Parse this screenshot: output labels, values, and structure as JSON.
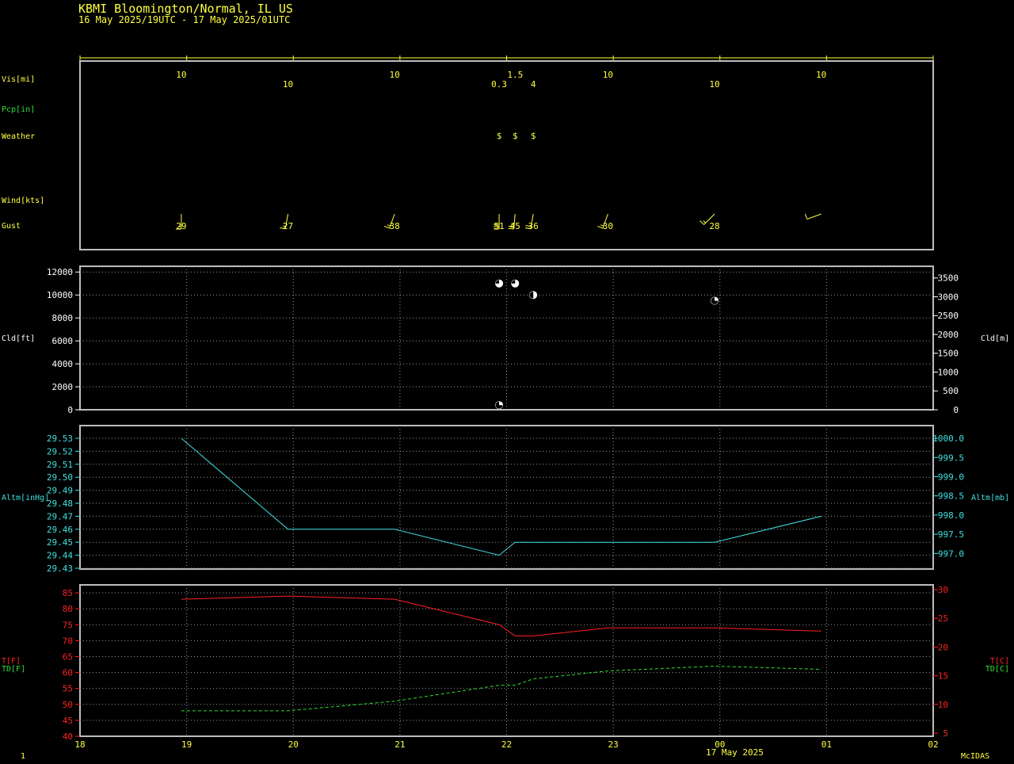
{
  "header": {
    "station": "KBMI  Bloomington/Normal, IL US",
    "period": "16 May 2025/19UTC - 17 May 2025/01UTC"
  },
  "footer": {
    "left_number": "1",
    "credit": "McIDAS",
    "date_label": "17 May 2025"
  },
  "colors": {
    "background": "#000000",
    "frame": "#bdbdbd",
    "yellow": "#ffff40",
    "green": "#30e030",
    "cyan": "#40e0e0",
    "red": "#ff2020",
    "white": "#ffffff"
  },
  "labels": {
    "vis": "Vis[mi]",
    "pcp": "Pcp[in]",
    "weather": "Weather",
    "wind": "Wind[kts]",
    "gust": "Gust",
    "cld_ft": "Cld[ft]",
    "cld_m": "Cld[m]",
    "altm_inhg": "Altm[inHg]",
    "altm_mb": "Altm[mb]",
    "t_f": "T[F]",
    "td_f": "TD[F]",
    "t_c": "T[C]",
    "td_c": "TD[C]"
  },
  "chart_data": {
    "type": "line",
    "x_axis": {
      "unit": "hour UTC",
      "range": [
        18,
        26
      ],
      "ticks": [
        18,
        19,
        20,
        21,
        22,
        23,
        24,
        25,
        26
      ],
      "tick_labels": [
        "18",
        "19",
        "20",
        "21",
        "22",
        "23",
        "00",
        "01",
        "02"
      ]
    },
    "observations": [
      {
        "time": 18.95,
        "vis": "10",
        "vis_level": "upper",
        "weather": "",
        "wind_dir": 180,
        "wind_speed": 15,
        "gust": "29"
      },
      {
        "time": 19.95,
        "vis": "10",
        "vis_level": "lower",
        "weather": "",
        "wind_dir": 190,
        "wind_speed": 15,
        "gust": "27"
      },
      {
        "time": 20.95,
        "vis": "10",
        "vis_level": "upper",
        "weather": "",
        "wind_dir": 200,
        "wind_speed": 15,
        "gust": "38"
      },
      {
        "time": 21.93,
        "vis": "0.3",
        "vis_level": "lower",
        "weather": "$",
        "wind_dir": 180,
        "wind_speed": 30,
        "gust": "51"
      },
      {
        "time": 22.08,
        "vis": "1.5",
        "vis_level": "upper",
        "weather": "$",
        "wind_dir": 185,
        "wind_speed": 25,
        "gust": "45"
      },
      {
        "time": 22.25,
        "vis": "4",
        "vis_level": "lower",
        "weather": "$",
        "wind_dir": 190,
        "wind_speed": 20,
        "gust": "36"
      },
      {
        "time": 22.95,
        "vis": "10",
        "vis_level": "upper",
        "weather": "",
        "wind_dir": 200,
        "wind_speed": 15,
        "gust": "30"
      },
      {
        "time": 23.95,
        "vis": "10",
        "vis_level": "lower",
        "weather": "",
        "wind_dir": 225,
        "wind_speed": 15,
        "gust": "28"
      },
      {
        "time": 24.95,
        "vis": "10",
        "vis_level": "upper",
        "weather": "",
        "wind_dir": 250,
        "wind_speed": 10,
        "gust": ""
      }
    ],
    "cloud": {
      "ylabel_left": "Cld[ft]",
      "ylabel_right": "Cld[m]",
      "ylim_ft": [
        0,
        12500
      ],
      "yticks_ft": [
        0,
        2000,
        4000,
        6000,
        8000,
        10000,
        12000
      ],
      "yticks_m": [
        0,
        500,
        1000,
        1500,
        2000,
        2500,
        3000,
        3500
      ],
      "points": [
        {
          "time": 21.93,
          "height_ft": 11000,
          "cover": "broken"
        },
        {
          "time": 22.08,
          "height_ft": 11000,
          "cover": "broken"
        },
        {
          "time": 22.25,
          "height_ft": 10000,
          "cover": "scattered"
        },
        {
          "time": 23.95,
          "height_ft": 9500,
          "cover": "few"
        },
        {
          "time": 21.93,
          "height_ft": 400,
          "cover": "few"
        }
      ]
    },
    "altimeter": {
      "ylabel_left": "Altm[inHg]",
      "ylabel_right": "Altm[mb]",
      "ylim_inhg": [
        29.43,
        29.53
      ],
      "yticks_inhg": [
        29.43,
        29.44,
        29.45,
        29.46,
        29.47,
        29.48,
        29.49,
        29.5,
        29.51,
        29.52,
        29.53
      ],
      "yticks_mb": [
        997.0,
        997.5,
        998.0,
        998.5,
        999.0,
        999.5,
        1000.0
      ],
      "x": [
        18.95,
        19.95,
        20.95,
        21.93,
        22.08,
        22.25,
        22.95,
        23.95,
        24.95
      ],
      "values": [
        29.53,
        29.46,
        29.46,
        29.44,
        29.45,
        29.45,
        29.45,
        29.45,
        29.47
      ]
    },
    "temperature": {
      "ylabel_left_t": "T[F]",
      "ylabel_left_td": "TD[F]",
      "ylabel_right_t": "T[C]",
      "ylabel_right_td": "TD[C]",
      "ylim_f": [
        40,
        87.5
      ],
      "yticks_f": [
        40,
        45,
        50,
        55,
        60,
        65,
        70,
        75,
        80,
        85
      ],
      "yticks_c": [
        5,
        10,
        15,
        20,
        25,
        30
      ],
      "series": [
        {
          "key": "t",
          "style": "solid",
          "x": [
            18.95,
            19.95,
            20.95,
            21.93,
            22.08,
            22.25,
            22.95,
            23.95,
            24.95
          ],
          "values": [
            83,
            84,
            83,
            75,
            71.5,
            71.5,
            74,
            74,
            73
          ]
        },
        {
          "key": "td",
          "style": "dashed",
          "x": [
            18.95,
            19.95,
            20.95,
            21.93,
            22.08,
            22.25,
            22.95,
            23.95,
            24.95
          ],
          "values": [
            48,
            48,
            51,
            56,
            56,
            58,
            60.5,
            62,
            61
          ]
        }
      ]
    }
  }
}
